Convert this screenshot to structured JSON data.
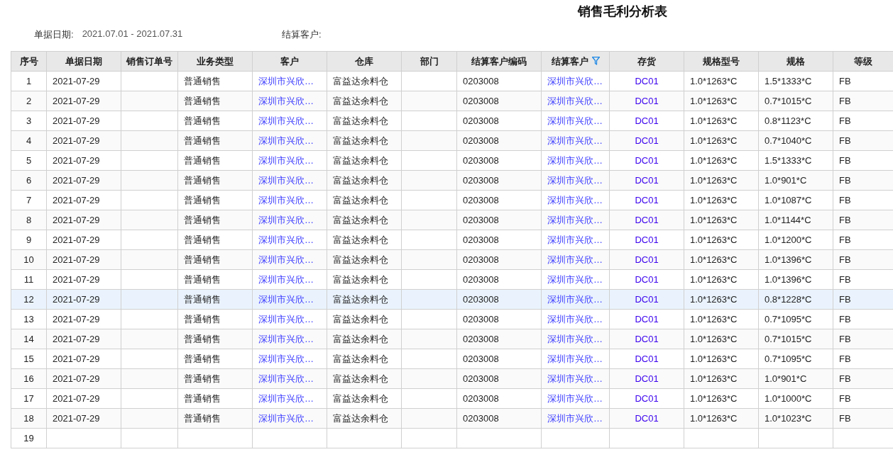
{
  "title": "销售毛利分析表",
  "filters": [
    {
      "label": "单据日期:",
      "value": "2021.07.01 - 2021.07.31"
    },
    {
      "label": "结算客户:"
    }
  ],
  "table": {
    "columns": [
      {
        "label": "序号",
        "kind": "index",
        "filter": false
      },
      {
        "label": "单据日期",
        "kind": "text",
        "filter": false
      },
      {
        "label": "销售订单号",
        "kind": "text",
        "filter": false
      },
      {
        "label": "业务类型",
        "kind": "text",
        "filter": false
      },
      {
        "label": "客户",
        "kind": "link",
        "filter": false
      },
      {
        "label": "仓库",
        "kind": "text",
        "filter": false
      },
      {
        "label": "部门",
        "kind": "text",
        "filter": false
      },
      {
        "label": "结算客户编码",
        "kind": "text",
        "filter": false
      },
      {
        "label": "结算客户",
        "kind": "link",
        "filter": true
      },
      {
        "label": "存货",
        "kind": "code",
        "filter": false
      },
      {
        "label": "规格型号",
        "kind": "text",
        "filter": false
      },
      {
        "label": "规格",
        "kind": "text",
        "filter": false
      },
      {
        "label": "等级",
        "kind": "text",
        "filter": false
      }
    ],
    "rows": [
      {
        "selected": false,
        "cells": [
          "1",
          "2021-07-29",
          null,
          "普通销售",
          "深圳市兴欣…",
          "富益达余料仓",
          null,
          "0203008",
          "深圳市兴欣…",
          "DC01",
          "1.0*1263*C",
          "1.5*1333*C",
          "FB"
        ]
      },
      {
        "selected": false,
        "cells": [
          "2",
          "2021-07-29",
          null,
          "普通销售",
          "深圳市兴欣…",
          "富益达余料仓",
          null,
          "0203008",
          "深圳市兴欣…",
          "DC01",
          "1.0*1263*C",
          "0.7*1015*C",
          "FB"
        ]
      },
      {
        "selected": false,
        "cells": [
          "3",
          "2021-07-29",
          null,
          "普通销售",
          "深圳市兴欣…",
          "富益达余料仓",
          null,
          "0203008",
          "深圳市兴欣…",
          "DC01",
          "1.0*1263*C",
          "0.8*1123*C",
          "FB"
        ]
      },
      {
        "selected": false,
        "cells": [
          "4",
          "2021-07-29",
          null,
          "普通销售",
          "深圳市兴欣…",
          "富益达余料仓",
          null,
          "0203008",
          "深圳市兴欣…",
          "DC01",
          "1.0*1263*C",
          "0.7*1040*C",
          "FB"
        ]
      },
      {
        "selected": false,
        "cells": [
          "5",
          "2021-07-29",
          null,
          "普通销售",
          "深圳市兴欣…",
          "富益达余料仓",
          null,
          "0203008",
          "深圳市兴欣…",
          "DC01",
          "1.0*1263*C",
          "1.5*1333*C",
          "FB"
        ]
      },
      {
        "selected": false,
        "cells": [
          "6",
          "2021-07-29",
          null,
          "普通销售",
          "深圳市兴欣…",
          "富益达余料仓",
          null,
          "0203008",
          "深圳市兴欣…",
          "DC01",
          "1.0*1263*C",
          "1.0*901*C",
          "FB"
        ]
      },
      {
        "selected": false,
        "cells": [
          "7",
          "2021-07-29",
          null,
          "普通销售",
          "深圳市兴欣…",
          "富益达余料仓",
          null,
          "0203008",
          "深圳市兴欣…",
          "DC01",
          "1.0*1263*C",
          "1.0*1087*C",
          "FB"
        ]
      },
      {
        "selected": false,
        "cells": [
          "8",
          "2021-07-29",
          null,
          "普通销售",
          "深圳市兴欣…",
          "富益达余料仓",
          null,
          "0203008",
          "深圳市兴欣…",
          "DC01",
          "1.0*1263*C",
          "1.0*1144*C",
          "FB"
        ]
      },
      {
        "selected": false,
        "cells": [
          "9",
          "2021-07-29",
          null,
          "普通销售",
          "深圳市兴欣…",
          "富益达余料仓",
          null,
          "0203008",
          "深圳市兴欣…",
          "DC01",
          "1.0*1263*C",
          "1.0*1200*C",
          "FB"
        ]
      },
      {
        "selected": false,
        "cells": [
          "10",
          "2021-07-29",
          null,
          "普通销售",
          "深圳市兴欣…",
          "富益达余料仓",
          null,
          "0203008",
          "深圳市兴欣…",
          "DC01",
          "1.0*1263*C",
          "1.0*1396*C",
          "FB"
        ]
      },
      {
        "selected": false,
        "cells": [
          "11",
          "2021-07-29",
          null,
          "普通销售",
          "深圳市兴欣…",
          "富益达余料仓",
          null,
          "0203008",
          "深圳市兴欣…",
          "DC01",
          "1.0*1263*C",
          "1.0*1396*C",
          "FB"
        ]
      },
      {
        "selected": true,
        "cells": [
          "12",
          "2021-07-29",
          null,
          "普通销售",
          "深圳市兴欣…",
          "富益达余料仓",
          null,
          "0203008",
          "深圳市兴欣…",
          "DC01",
          "1.0*1263*C",
          "0.8*1228*C",
          "FB"
        ]
      },
      {
        "selected": false,
        "cells": [
          "13",
          "2021-07-29",
          null,
          "普通销售",
          "深圳市兴欣…",
          "富益达余料仓",
          null,
          "0203008",
          "深圳市兴欣…",
          "DC01",
          "1.0*1263*C",
          "0.7*1095*C",
          "FB"
        ]
      },
      {
        "selected": false,
        "cells": [
          "14",
          "2021-07-29",
          null,
          "普通销售",
          "深圳市兴欣…",
          "富益达余料仓",
          null,
          "0203008",
          "深圳市兴欣…",
          "DC01",
          "1.0*1263*C",
          "0.7*1015*C",
          "FB"
        ]
      },
      {
        "selected": false,
        "cells": [
          "15",
          "2021-07-29",
          null,
          "普通销售",
          "深圳市兴欣…",
          "富益达余料仓",
          null,
          "0203008",
          "深圳市兴欣…",
          "DC01",
          "1.0*1263*C",
          "0.7*1095*C",
          "FB"
        ]
      },
      {
        "selected": false,
        "cells": [
          "16",
          "2021-07-29",
          null,
          "普通销售",
          "深圳市兴欣…",
          "富益达余料仓",
          null,
          "0203008",
          "深圳市兴欣…",
          "DC01",
          "1.0*1263*C",
          "1.0*901*C",
          "FB"
        ]
      },
      {
        "selected": false,
        "cells": [
          "17",
          "2021-07-29",
          null,
          "普通销售",
          "深圳市兴欣…",
          "富益达余料仓",
          null,
          "0203008",
          "深圳市兴欣…",
          "DC01",
          "1.0*1263*C",
          "1.0*1000*C",
          "FB"
        ]
      },
      {
        "selected": false,
        "cells": [
          "18",
          "2021-07-29",
          null,
          "普通销售",
          "深圳市兴欣…",
          "富益达余料仓",
          null,
          "0203008",
          "深圳市兴欣…",
          "DC01",
          "1.0*1263*C",
          "1.0*1023*C",
          "FB"
        ]
      },
      {
        "selected": false,
        "cells": [
          "19"
        ]
      }
    ]
  }
}
